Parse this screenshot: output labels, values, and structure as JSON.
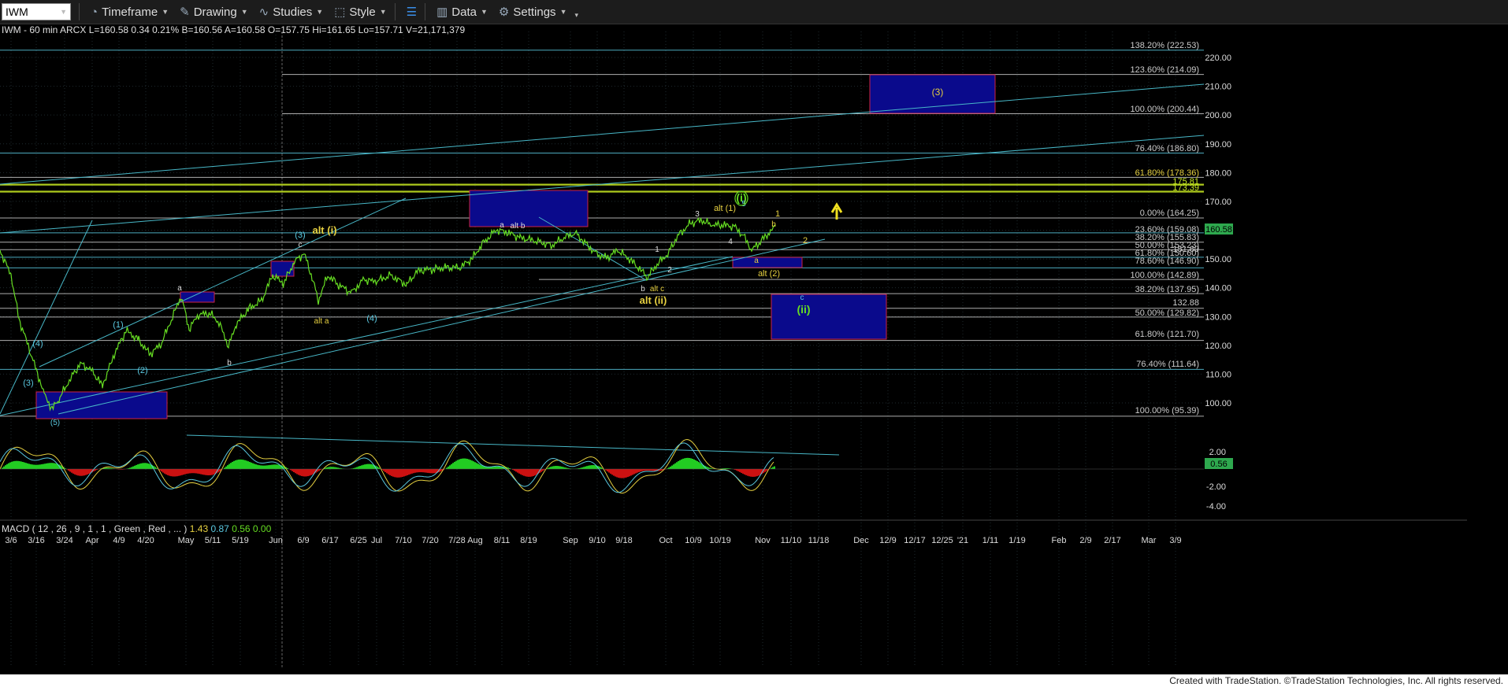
{
  "toolbar": {
    "symbol": "IWM",
    "timeframe": "Timeframe",
    "drawing": "Drawing",
    "studies": "Studies",
    "style": "Style",
    "data": "Data",
    "settings": "Settings"
  },
  "header": {
    "symbol_info": "IWM - 60 min ARCX",
    "quote": "L=160.58 0.34 0.21% B=160.56 A=160.58 O=157.75 Hi=161.65 Lo=157.71 V=21,171,379"
  },
  "macd": {
    "label": "MACD ( 12 , 26 , 9 , 1 , 1 , Green , Red , ... )",
    "v1": "1.43",
    "v2": "0.87",
    "v3": "0.56",
    "v4": "0.00",
    "axis": [
      "2.00",
      "-2.00",
      "-4.00"
    ],
    "current": "0.56"
  },
  "price_axis": [
    "220.00",
    "210.00",
    "200.00",
    "190.00",
    "180.00",
    "170.00",
    "160.00",
    "150.00",
    "140.00",
    "130.00",
    "120.00",
    "110.00",
    "100.00"
  ],
  "current_price": "160.58",
  "date_axis": [
    "3/6",
    "3/16",
    "3/24",
    "Apr",
    "4/9",
    "4/20",
    "May",
    "5/11",
    "5/19",
    "Jun",
    "6/9",
    "6/17",
    "6/25",
    "Jul",
    "7/10",
    "7/20",
    "7/28",
    "Aug",
    "8/11",
    "8/19",
    "Sep",
    "9/10",
    "9/18",
    "Oct",
    "10/9",
    "10/19",
    "Nov",
    "11/10",
    "11/18",
    "Dec",
    "12/9",
    "12/17",
    "12/25",
    "'21",
    "1/11",
    "1/19",
    "Feb",
    "2/9",
    "2/17",
    "Mar",
    "3/9"
  ],
  "fib_labels": [
    "138.20% (222.53)",
    "123.60% (214.09)",
    "100.00% (200.44)",
    "76.40% (186.80)",
    "61.80% (178.36)",
    "175.81",
    "173.39",
    "0.00% (164.25)",
    "23.60% (159.08)",
    "38.20% (155.83)",
    "50.00% (153.23)",
    "61.80% (150.60)",
    "151.60",
    "78.60% (146.90)",
    "100.00% (142.89)",
    "38.20% (137.95)",
    "132.88",
    "50.00% (129.82)",
    "61.80% (121.70)",
    "76.40% (111.64)",
    "100.00% (95.39)"
  ],
  "wave_labels": {
    "w3_target": "(3)",
    "alt_i": "alt (i)",
    "alt_ii": "alt (ii)",
    "ii": "(ii)",
    "i_circle": "(i)",
    "alt_1": "alt (1)",
    "alt_2": "alt (2)",
    "alt_a": "alt a",
    "alt_b": "alt b",
    "alt_c": "alt c",
    "w4": "(4)",
    "w5": "(5)",
    "w1": "(1)",
    "w2": "(2)",
    "w3_left": "(3)",
    "w4_left": "(4)",
    "w3_mid": "(3)",
    "a": "a",
    "b": "b",
    "c": "c",
    "n1": "1",
    "n2": "2",
    "n3": "3",
    "n4": "4",
    "n5": "5"
  },
  "colors": {
    "background": "#000000",
    "price_line": "#66dd22",
    "fib_line": "#cccccc",
    "trend_line": "#48b8c8",
    "box_fill": "#0a0a8c",
    "box_border": "#cc2244",
    "yellow_line": "#ccee22",
    "label_yellow": "#e6d040",
    "label_cyan": "#5ac8e0"
  },
  "footer": "Created with TradeStation. ©TradeStation Technologies, Inc. All rights reserved."
}
